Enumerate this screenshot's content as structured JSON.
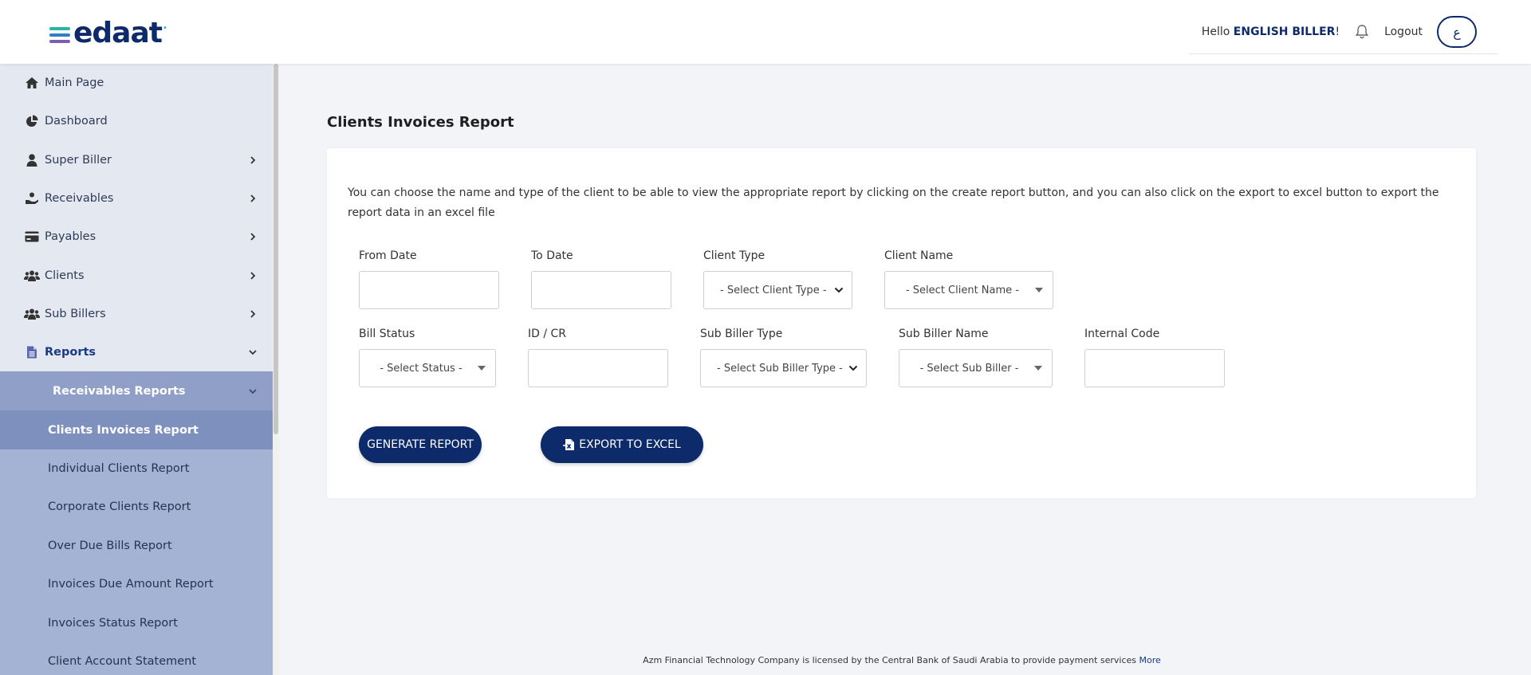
{
  "header": {
    "logo_text": "edaat",
    "hello_prefix": "Hello",
    "user_name": "ENGLISH BILLER",
    "hello_suffix": "!",
    "logout_label": "Logout",
    "lang_label": "ع"
  },
  "sidebar": {
    "items": [
      {
        "label": "Main Page",
        "icon": "home-icon"
      },
      {
        "label": "Dashboard",
        "icon": "pie-chart-icon"
      },
      {
        "label": "Super Biller",
        "icon": "user-icon"
      },
      {
        "label": "Receivables",
        "icon": "hand-coin-icon"
      },
      {
        "label": "Payables",
        "icon": "credit-card-icon"
      },
      {
        "label": "Clients",
        "icon": "users-icon"
      },
      {
        "label": "Sub Billers",
        "icon": "users-icon"
      },
      {
        "label": "Reports",
        "icon": "file-icon"
      }
    ],
    "sub_head": "Receivables Reports",
    "sub_items": [
      "Clients Invoices Report",
      "Individual Clients Report",
      "Corporate Clients Report",
      "Over Due Bills Report",
      "Invoices Due Amount Report",
      "Invoices Status Report",
      "Client Account Statement"
    ]
  },
  "main": {
    "title": "Clients Invoices Report",
    "description": "You can choose the name and type of the client to be able to view the appropriate report by clicking on the create report button, and you can also click on the export to excel button to export the report data in an excel file",
    "fields": {
      "from_date": {
        "label": "From Date",
        "value": ""
      },
      "to_date": {
        "label": "To Date",
        "value": ""
      },
      "client_type": {
        "label": "Client Type",
        "value": "- Select Client Type -"
      },
      "client_name": {
        "label": "Client Name",
        "value": "- Select Client Name -"
      },
      "bill_status": {
        "label": "Bill Status",
        "value": "- Select Status -"
      },
      "id_cr": {
        "label": "ID / CR",
        "value": ""
      },
      "sub_biller_type": {
        "label": "Sub Biller Type",
        "value": "- Select Sub Biller Type -"
      },
      "sub_biller_name": {
        "label": "Sub Biller Name",
        "value": "- Select Sub Biller -"
      },
      "internal_code": {
        "label": "Internal Code",
        "value": ""
      }
    },
    "generate_label": "GENERATE REPORT",
    "export_label": "EXPORT TO EXCEL"
  },
  "footer": {
    "text": "Azm Financial Technology Company is licensed by the Central Bank of Saudi Arabia to provide payment services",
    "more_label": "More"
  },
  "colors": {
    "brand_navy": "#0d2b6b",
    "sidebar_bg": "#e4e8f1",
    "sub_list_bg": "#a4b2d3",
    "active_bg": "#7e90bd"
  }
}
